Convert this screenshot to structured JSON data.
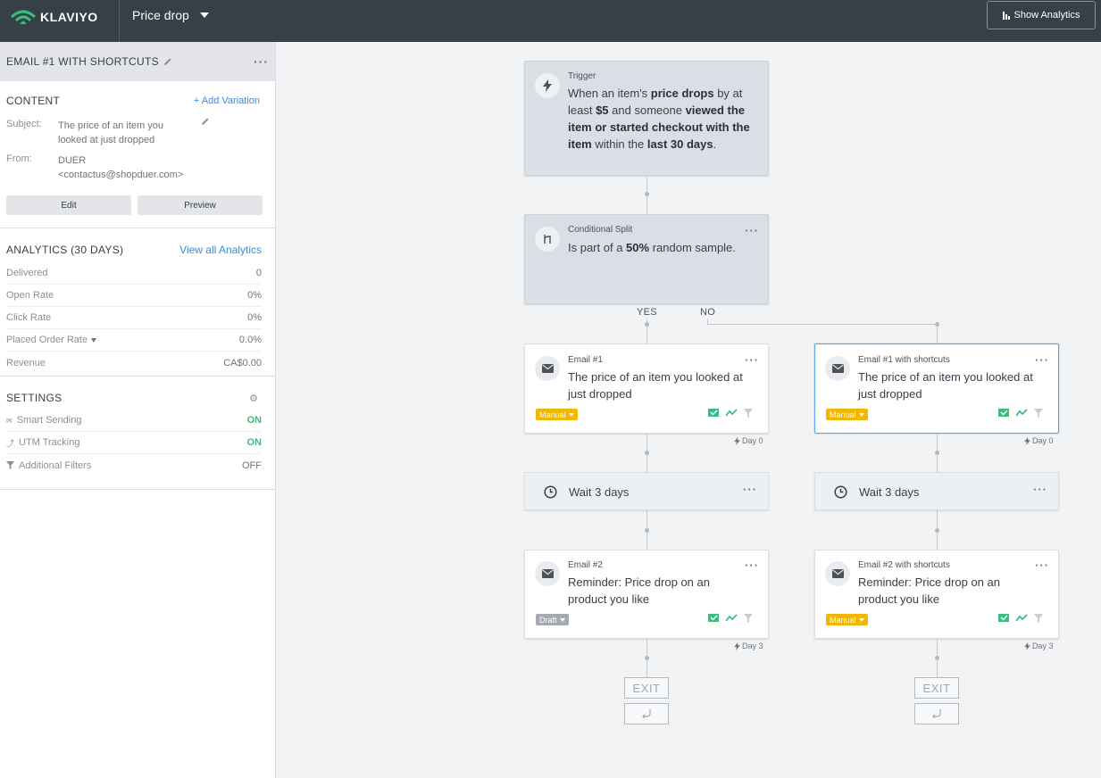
{
  "topbar": {
    "logo_text": "KLAVIYO",
    "flow_name": "Price drop",
    "show_analytics": "Show Analytics"
  },
  "sidebar": {
    "title": "EMAIL #1 WITH SHORTCUTS",
    "content": {
      "title": "CONTENT",
      "add_variation": "+ Add Variation",
      "subject_label": "Subject:",
      "subject_value": "The price of an item you looked at just dropped",
      "from_label": "From:",
      "from_name": "DUER",
      "from_email": "<contactus@shopduer.com>",
      "edit_label": "Edit",
      "preview_label": "Preview"
    },
    "analytics": {
      "title": "ANALYTICS (30 DAYS)",
      "view_all": "View all Analytics",
      "rows": [
        {
          "label": "Delivered",
          "value": "0"
        },
        {
          "label": "Open Rate",
          "value": "0%"
        },
        {
          "label": "Click Rate",
          "value": "0%"
        },
        {
          "label": "Placed Order Rate",
          "value": "0.0%"
        },
        {
          "label": "Revenue",
          "value": "CA$0.00"
        }
      ]
    },
    "settings": {
      "title": "SETTINGS",
      "rows": [
        {
          "label": "Smart Sending",
          "value": "ON"
        },
        {
          "label": "UTM Tracking",
          "value": "ON"
        },
        {
          "label": "Additional Filters",
          "value": "OFF"
        }
      ]
    }
  },
  "flow": {
    "trigger": {
      "label": "Trigger",
      "t1": "When an item's ",
      "b1": "price drops",
      "t2": " by at least ",
      "b2": "$5",
      "t3": " and someone ",
      "b3": "viewed the item or started checkout with the item",
      "t4": " within the ",
      "b4": "last 30 days",
      "t5": "."
    },
    "split": {
      "label": "Conditional Split",
      "t1": "Is part of a ",
      "b1": "50%",
      "t2": " random sample."
    },
    "yes_label": "YES",
    "no_label": "NO",
    "email1": {
      "label": "Email #1",
      "text": "The price of an item you looked at just dropped",
      "badge": "Manual",
      "day": "Day 0"
    },
    "email1b": {
      "label": "Email #1 with shortcuts",
      "text": "The price of an item you looked at just dropped",
      "badge": "Manual",
      "day": "Day 0"
    },
    "wait1": "Wait 3 days",
    "wait2": "Wait 3 days",
    "email2": {
      "label": "Email #2",
      "text": "Reminder: Price drop on an product you like",
      "badge": "Draft",
      "day": "Day 3"
    },
    "email2b": {
      "label": "Email #2 with shortcuts",
      "text": "Reminder: Price drop on an product you like",
      "badge": "Manual",
      "day": "Day 3"
    },
    "exit_label": "EXIT"
  },
  "colors": {
    "topbar": "#373f47",
    "accent_link": "#3a8ad8",
    "on_green": "#3dbd7d",
    "manual_badge": "#f2b705",
    "selected_border": "#5aa7e6"
  }
}
